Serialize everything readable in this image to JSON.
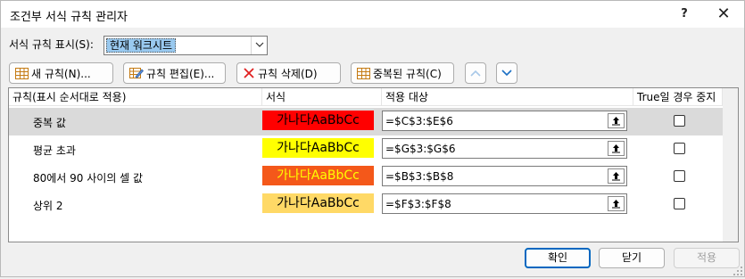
{
  "window": {
    "title": "조건부 서식 규칙 관리자",
    "help": "?",
    "close": "✕"
  },
  "scope": {
    "label": "서식 규칙 표시(S):",
    "value": "현재 워크시트"
  },
  "toolbar": {
    "new_rule": "새 규칙(N)...",
    "edit_rule": "규칙 편집(E)...",
    "delete_rule": "규칙 삭제(D)",
    "duplicate_rule": "중복된 규칙(C)"
  },
  "table": {
    "columns": [
      "규칙(표시 순서대로 적용)",
      "서식",
      "적용 대상",
      "True일 경우 중지"
    ],
    "rows": [
      {
        "name": "중복 값",
        "preview": "가나다AaBbCc",
        "bg": "#ff0000",
        "fg": "#000000",
        "applies": "=$C$3:$E$6",
        "stop": false
      },
      {
        "name": "평균 초과",
        "preview": "가나다AaBbCc",
        "bg": "#ffff00",
        "fg": "#000000",
        "applies": "=$G$3:$G$6",
        "stop": false
      },
      {
        "name": "80에서 90 사이의 셀 값",
        "preview": "가나다AaBbCc",
        "bg": "#f4581a",
        "fg": "#ffff00",
        "applies": "=$B$3:$B$8",
        "stop": false
      },
      {
        "name": "상위 2",
        "preview": "가나다AaBbCc",
        "bg": "#ffd966",
        "fg": "#000000",
        "applies": "=$F$3:$F$8",
        "stop": false
      }
    ]
  },
  "footer": {
    "ok": "확인",
    "close": "닫기",
    "apply": "적용"
  },
  "colors": {
    "selected_row": "#dadada",
    "accent": "#0067c0"
  }
}
